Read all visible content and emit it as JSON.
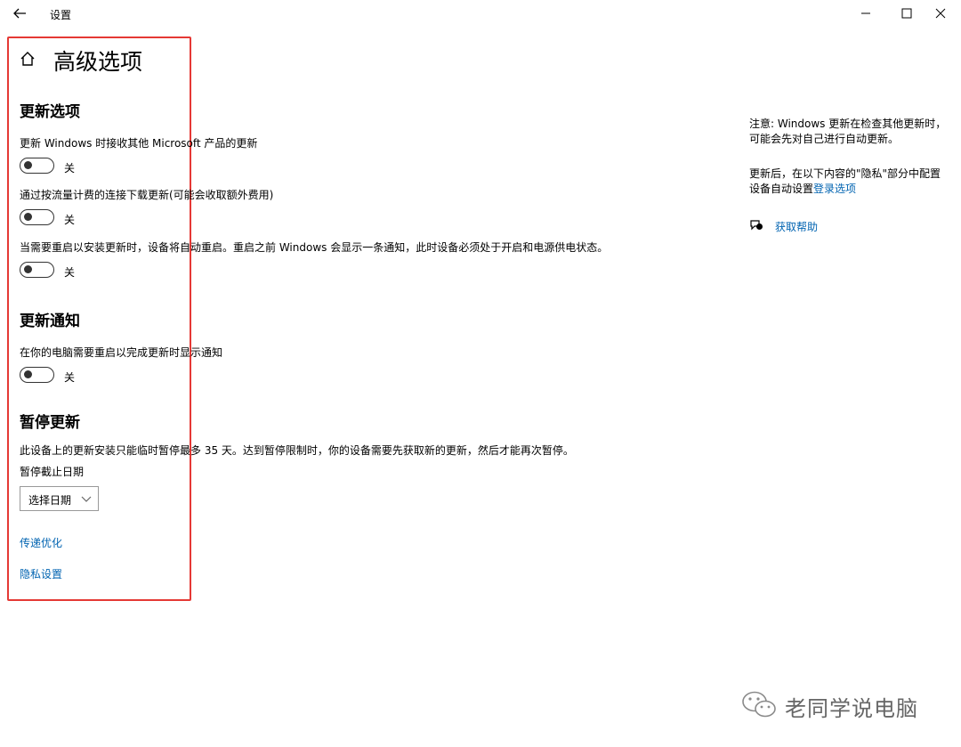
{
  "window": {
    "title": "设置",
    "back_icon": "arrow-left-icon",
    "minimize_icon": "minimize-icon",
    "maximize_icon": "maximize-icon",
    "close_icon": "close-icon"
  },
  "header": {
    "home_icon": "home-icon",
    "title": "高级选项"
  },
  "update_options": {
    "title": "更新选项",
    "items": [
      {
        "desc": "更新 Windows 时接收其他 Microsoft 产品的更新",
        "state": "关"
      },
      {
        "desc": "通过按流量计费的连接下载更新(可能会收取额外费用)",
        "state": "关"
      },
      {
        "desc": "当需要重启以安装更新时，设备将自动重启。重启之前 Windows 会显示一条通知，此时设备必须处于开启和电源供电状态。",
        "state": "关"
      }
    ]
  },
  "update_notify": {
    "title": "更新通知",
    "items": [
      {
        "desc": "在你的电脑需要重启以完成更新时显示通知",
        "state": "关"
      }
    ]
  },
  "pause_updates": {
    "title": "暂停更新",
    "desc": "此设备上的更新安装只能临时暂停最多 35 天。达到暂停限制时，你的设备需要先获取新的更新，然后才能再次暂停。",
    "date_label": "暂停截止日期",
    "date_select": "选择日期"
  },
  "links": {
    "delivery": "传递优化",
    "privacy": "隐私设置"
  },
  "side": {
    "note": "注意: Windows 更新在检查其他更新时，可能会先对自己进行自动更新。",
    "privacy_text": "更新后，在以下内容的\"隐私\"部分中配置设备自动设置",
    "privacy_link": "登录选项",
    "help_icon": "chat-help-icon",
    "help_link": "获取帮助"
  },
  "watermark": {
    "text": "老同学说电脑"
  },
  "colors": {
    "highlight": "#e53935",
    "link": "#0063b1"
  }
}
